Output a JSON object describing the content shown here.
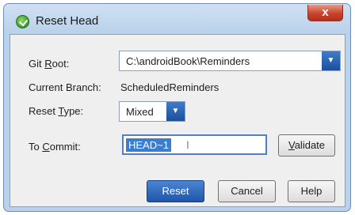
{
  "window": {
    "title": "Reset Head",
    "close_glyph": "x"
  },
  "form": {
    "git_root": {
      "label_pre": "Git ",
      "label_key": "R",
      "label_post": "oot:",
      "value": "C:\\androidBook\\Reminders"
    },
    "current_branch": {
      "label": "Current Branch:",
      "value": "ScheduledReminders"
    },
    "reset_type": {
      "label_pre": "Reset ",
      "label_key": "T",
      "label_post": "ype:",
      "value": "Mixed"
    },
    "to_commit": {
      "label_pre": "To ",
      "label_key": "C",
      "label_post": "ommit:",
      "value": "HEAD~1"
    }
  },
  "buttons": {
    "validate_key": "V",
    "validate_rest": "alidate",
    "reset": "Reset",
    "cancel": "Cancel",
    "help": "Help"
  },
  "icons": {
    "app": "git-reset-icon",
    "dropdown": "chevron-down-icon",
    "cursor": "text-cursor-icon"
  },
  "colors": {
    "accent": "#1f55a8",
    "close": "#c6452f",
    "selection": "#3b7ed1"
  }
}
